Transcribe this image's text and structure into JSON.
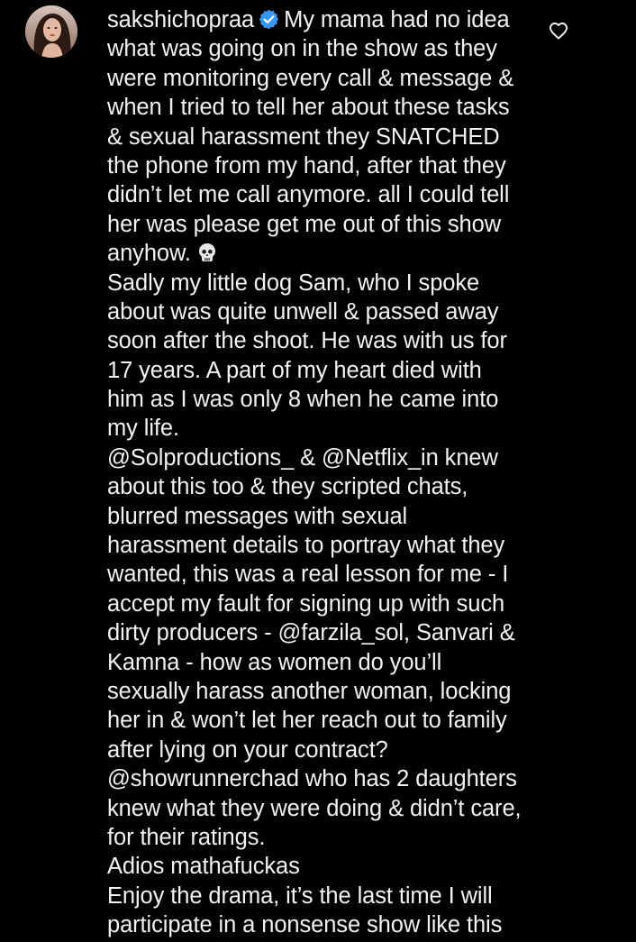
{
  "comment": {
    "username": "sakshichopraa",
    "verified": true,
    "first_line_text": "My mama had no idea",
    "lines": [
      "what was going on in the show as they",
      "were monitoring every call & message &",
      "when I tried to tell her about these tasks",
      "& sexual harassment they SNATCHED",
      "the phone from my hand, after that they",
      "didn’t let me call anymore. all I could tell",
      "her was please get me out of this show",
      "anyhow.",
      "Sadly my little dog Sam, who I spoke",
      "about was quite unwell & passed away",
      "soon after the shoot. He was with us for",
      "17 years. A part of my heart died with",
      "him as I was only 8 when he came into",
      "my life.",
      "@Solproductions_ & @Netflix_in knew",
      "about this too & they scripted chats,",
      "blurred messages with sexual",
      "harassment details to portray what they",
      "wanted, this was a real lesson for me - I",
      "accept my fault for signing up with such",
      "dirty producers - @farzila_sol, Sanvari &",
      "Kamna - how as women do you’ll",
      "sexually harass another woman, locking",
      "her in & won’t let her reach out to family",
      "after lying on your contract?",
      "@showrunnerchad who has 2 daughters",
      "knew what they were doing & didn’t care,",
      "for their ratings.",
      "Adios mathafuckas",
      "Enjoy the drama, it’s the last time I will",
      "participate in a nonsense show like this"
    ]
  },
  "icons": {
    "verified": "verified-badge-icon",
    "skull": "skull-emoji-icon",
    "like": "heart-outline-icon",
    "avatar": "user-avatar"
  },
  "colors": {
    "background": "#000000",
    "text": "#f2f2f2",
    "verified": "#3897f0"
  }
}
